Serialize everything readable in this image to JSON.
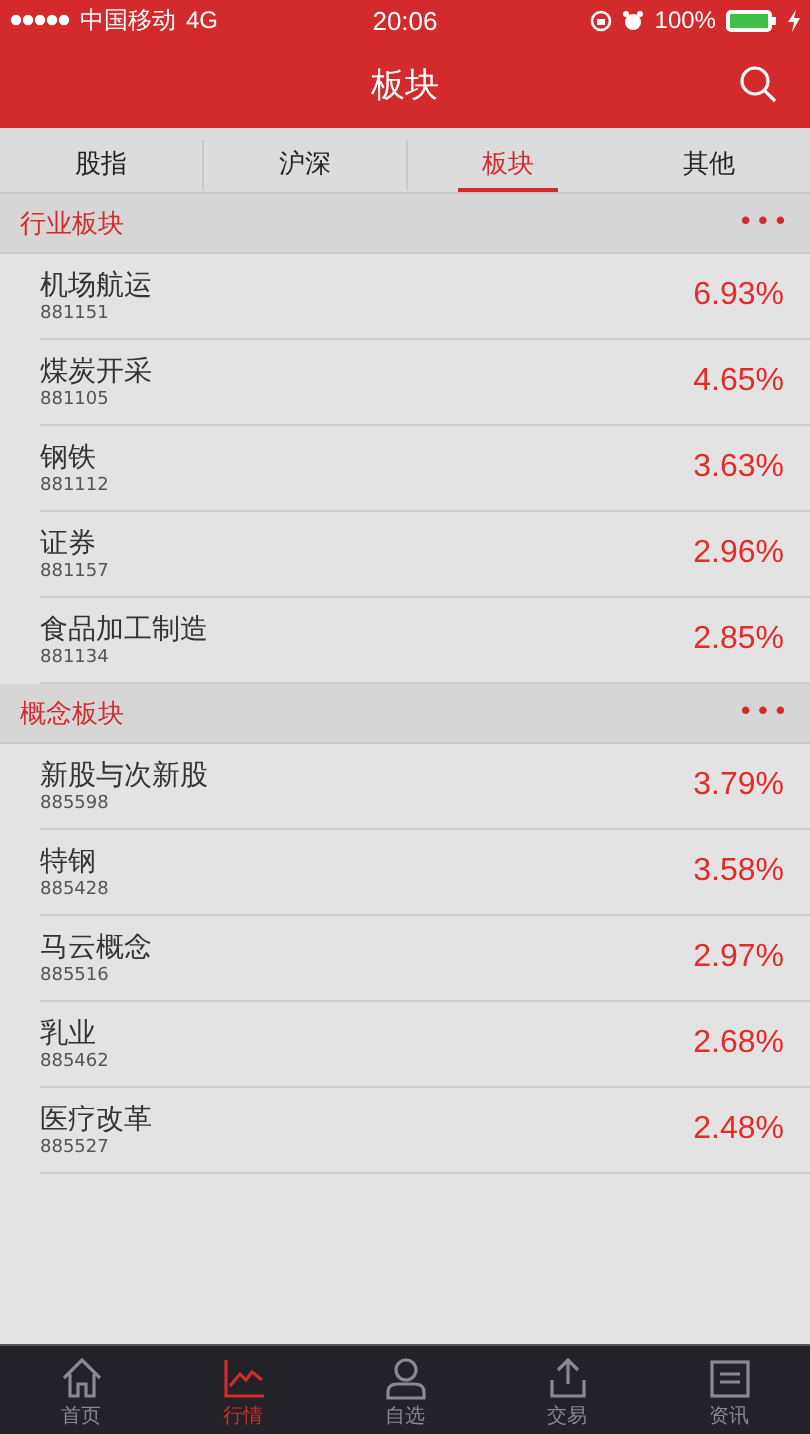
{
  "status_bar": {
    "carrier": "中国移动",
    "network": "4G",
    "time": "20:06",
    "battery": "100%"
  },
  "header": {
    "title": "板块"
  },
  "tabs": [
    {
      "label": "股指",
      "selected": false
    },
    {
      "label": "沪深",
      "selected": false
    },
    {
      "label": "板块",
      "selected": true
    },
    {
      "label": "其他",
      "selected": false
    }
  ],
  "sections": [
    {
      "title": "行业板块",
      "more": "•••",
      "rows": [
        {
          "name": "机场航运",
          "code": "881151",
          "change": "6.93%"
        },
        {
          "name": "煤炭开采",
          "code": "881105",
          "change": "4.65%"
        },
        {
          "name": "钢铁",
          "code": "881112",
          "change": "3.63%"
        },
        {
          "name": "证券",
          "code": "881157",
          "change": "2.96%"
        },
        {
          "name": "食品加工制造",
          "code": "881134",
          "change": "2.85%"
        }
      ]
    },
    {
      "title": "概念板块",
      "more": "•••",
      "rows": [
        {
          "name": "新股与次新股",
          "code": "885598",
          "change": "3.79%"
        },
        {
          "name": "特钢",
          "code": "885428",
          "change": "3.58%"
        },
        {
          "name": "马云概念",
          "code": "885516",
          "change": "2.97%"
        },
        {
          "name": "乳业",
          "code": "885462",
          "change": "2.68%"
        },
        {
          "name": "医疗改革",
          "code": "885527",
          "change": "2.48%"
        }
      ]
    }
  ],
  "bottom_nav": [
    {
      "label": "首页",
      "selected": false
    },
    {
      "label": "行情",
      "selected": true
    },
    {
      "label": "自选",
      "selected": false
    },
    {
      "label": "交易",
      "selected": false
    },
    {
      "label": "资讯",
      "selected": false
    }
  ]
}
